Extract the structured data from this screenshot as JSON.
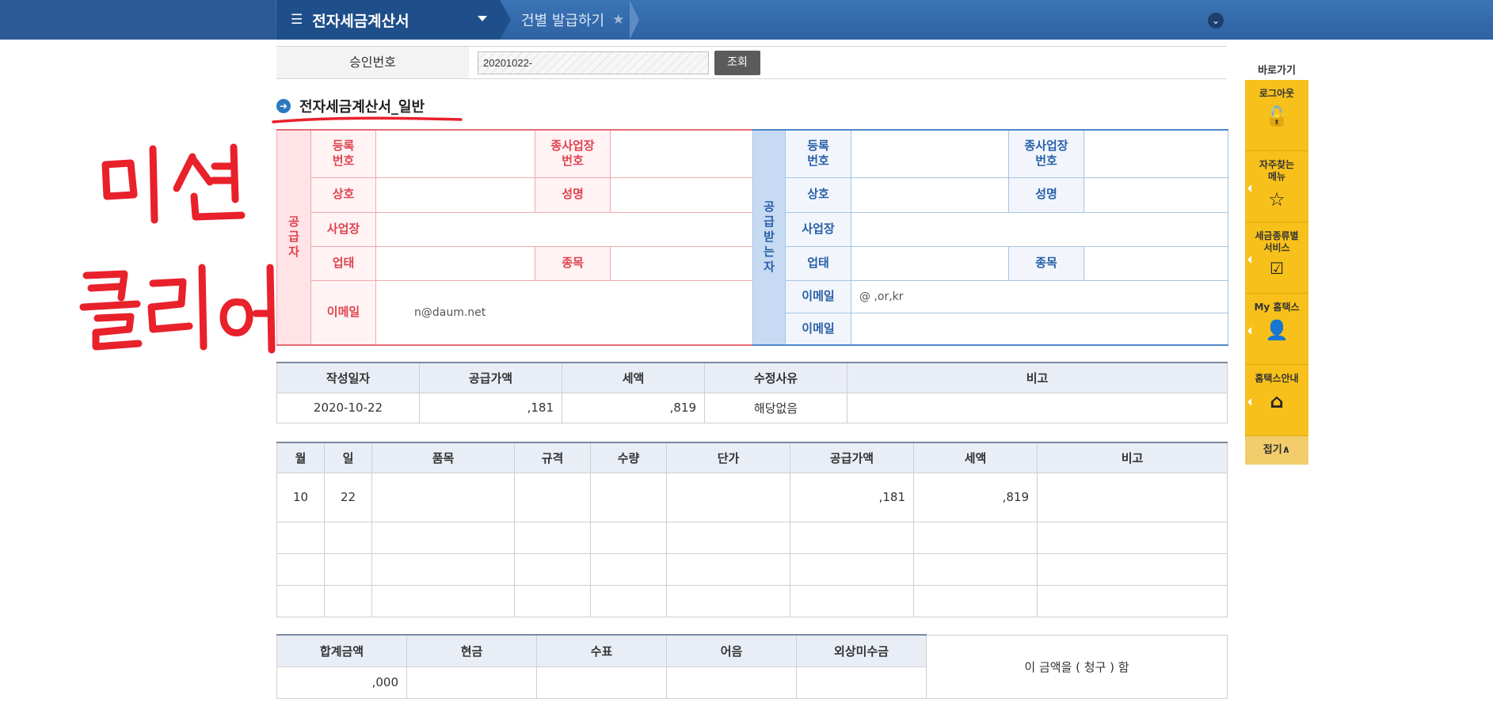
{
  "nav": {
    "menu_title": "전자세금계산서",
    "breadcrumb": "건별 발급하기"
  },
  "approval": {
    "label": "승인번호",
    "value": "20201022-",
    "lookup_button": "조회"
  },
  "section_title": "전자세금계산서_일반",
  "annotation": "미션 클리어",
  "supplier": {
    "side_label": "공급자",
    "reg_no_label": "등록\n번호",
    "branch_label": "종사업장\n번호",
    "company_label": "상호",
    "name_label": "성명",
    "address_label": "사업장",
    "biz_type_label": "업태",
    "biz_item_label": "종목",
    "email_label": "이메일",
    "email_value": "n@daum.net"
  },
  "buyer": {
    "side_label": "공급받는자",
    "reg_no_label": "등록\n번호",
    "branch_label": "종사업장\n번호",
    "company_label": "상호",
    "name_label": "성명",
    "address_label": "사업장",
    "biz_type_label": "업태",
    "biz_item_label": "종목",
    "email_label": "이메일",
    "email_value": "@   ,or,kr",
    "email2_label": "이메일"
  },
  "summary": {
    "headers": [
      "작성일자",
      "공급가액",
      "세액",
      "수정사유",
      "비고"
    ],
    "date": "2020-10-22",
    "supply": ",181",
    "tax": ",819",
    "reason": "해당없음",
    "note": ""
  },
  "items": {
    "headers": [
      "월",
      "일",
      "품목",
      "규격",
      "수량",
      "단가",
      "공급가액",
      "세액",
      "비고"
    ],
    "row": {
      "month": "10",
      "day": "22",
      "supply": ",181",
      "tax": ",819"
    }
  },
  "totals": {
    "headers": [
      "합계금액",
      "현금",
      "수표",
      "어음",
      "외상미수금"
    ],
    "total": ",000",
    "claim_text": "이 금액을 ( 청구 ) 함"
  },
  "quick_menu": {
    "title": "바로가기",
    "items": [
      {
        "label": "로그아웃",
        "icon": "unlock-icon"
      },
      {
        "label": "자주찾는\n메뉴",
        "icon": "star-icon"
      },
      {
        "label": "세금종류별\n서비스",
        "icon": "checkbox-icon"
      },
      {
        "label": "My 홈택스",
        "icon": "user-icon"
      },
      {
        "label": "홈택스안내",
        "icon": "home-icon"
      }
    ],
    "fold": "접기∧"
  },
  "colors": {
    "nav": "#2e62a3",
    "supplier_accent": "#e0434e",
    "buyer_accent": "#2860a8",
    "quick_menu": "#f7c01b",
    "handwriting": "#e8212b"
  }
}
